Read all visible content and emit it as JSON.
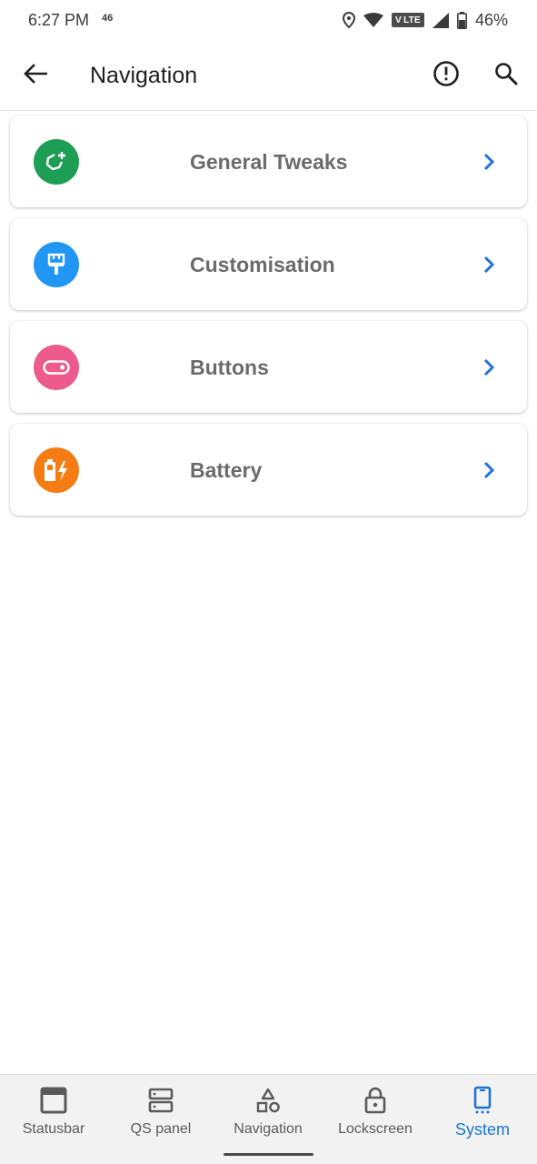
{
  "status_bar": {
    "time": "6:27 PM",
    "network": "46",
    "volte": "V LTE",
    "battery": "46%"
  },
  "app_bar": {
    "title": "Navigation",
    "back_icon": "arrow-back-icon",
    "info_icon": "info-icon",
    "search_icon": "search-icon"
  },
  "cards": [
    {
      "label": "General Tweaks",
      "icon": "tweak-icon",
      "color": "#1e9e55"
    },
    {
      "label": "Customisation",
      "icon": "brush-icon",
      "color": "#2196f3"
    },
    {
      "label": "Buttons",
      "icon": "toggle-icon",
      "color": "#ec5b8c"
    },
    {
      "label": "Battery",
      "icon": "battery-charging-icon",
      "color": "#f57c12"
    }
  ],
  "chevron_color": "#1e74d6",
  "bottom_nav": {
    "items": [
      {
        "label": "Statusbar",
        "icon": "statusbar-icon"
      },
      {
        "label": "QS panel",
        "icon": "qs-panel-icon"
      },
      {
        "label": "Navigation",
        "icon": "shapes-icon"
      },
      {
        "label": "Lockscreen",
        "icon": "lock-icon"
      },
      {
        "label": "System",
        "icon": "phone-icon",
        "active": true
      }
    ],
    "active_color": "#1976d2"
  }
}
